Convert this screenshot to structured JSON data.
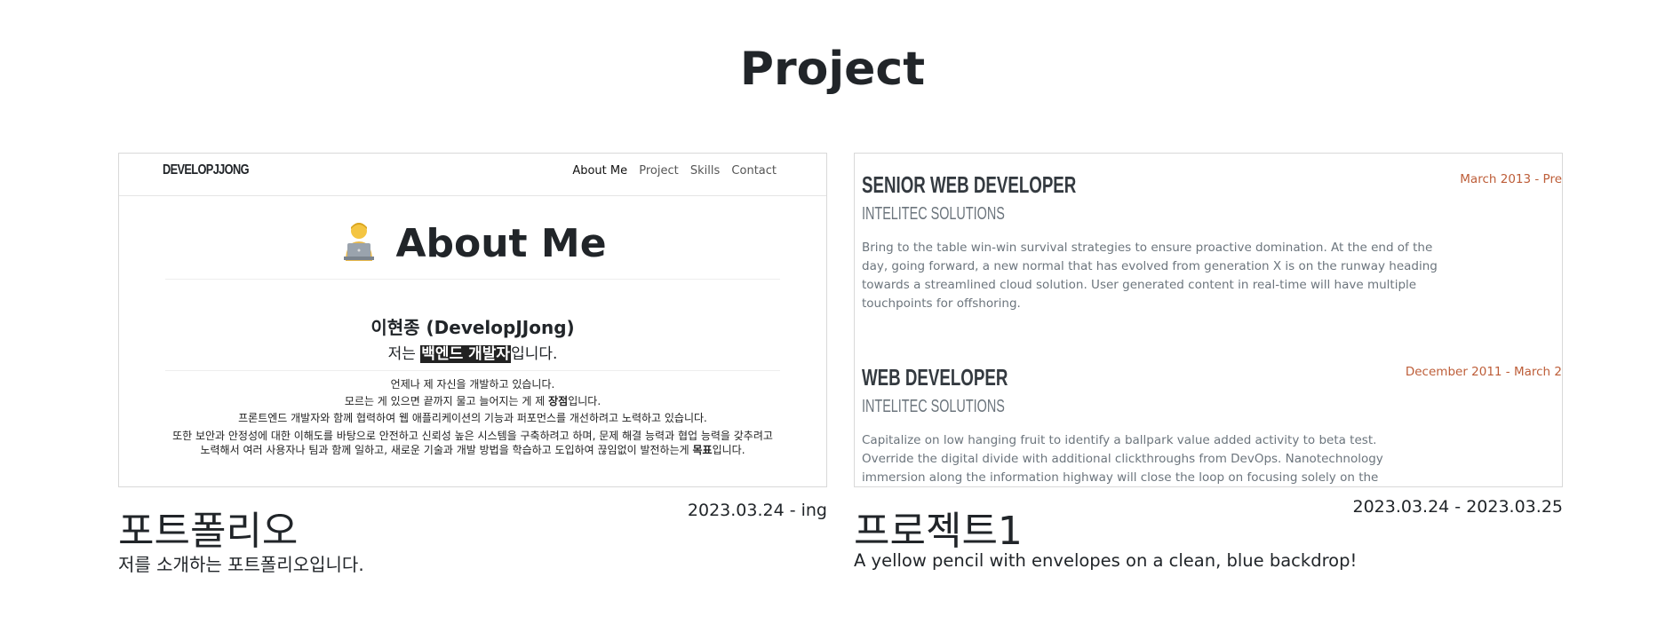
{
  "page_title": "Project",
  "projects": [
    {
      "title": "포트폴리오",
      "date": "2023.03.24 - ing",
      "description": "저를 소개하는 포트폴리오입니다.",
      "preview": {
        "brand": "DEVELOPJJONG",
        "nav": [
          "About Me",
          "Project",
          "Skills",
          "Contact"
        ],
        "heading": "About Me",
        "emoji_icon": "technologist-emoji",
        "name": "이현종 (DevelopJJong)",
        "role_prefix": "저는 ",
        "role_highlight": "백엔드 개발자",
        "role_suffix": "입니다.",
        "line1": "언제나 제 자신을 개발하고 있습니다.",
        "line2_prefix": "모르는 게 있으면 끝까지 물고 늘어지는 게 제 ",
        "line2_bold": "장점",
        "line2_suffix": "입니다.",
        "line3": "프론트엔드 개발자와 함께 협력하여 웹 애플리케이션의 기능과 퍼포먼스를 개선하려고 노력하고 있습니다.",
        "line4_prefix": "또한 보안과 안정성에 대한 이해도를 바탕으로 안전하고 신뢰성 높은 시스템을 구축하려고 하며, 문제 해결 능력과 협업 능력을 갖추려고 노력해서 여러 사용자나 팀과 함께 일하고, 새로운 기술과 개발 방법을 학습하고 도입하여 끊임없이 발전하는게 ",
        "line4_bold": "목표",
        "line4_suffix": "입니다."
      }
    },
    {
      "title": "프로젝트1",
      "date": "2023.03.24 - 2023.03.25",
      "description": "A yellow pencil with envelopes on a clean, blue backdrop!",
      "preview": {
        "jobs": [
          {
            "title": "SENIOR WEB DEVELOPER",
            "company": "INTELITEC SOLUTIONS",
            "date": "March 2013 - Pre",
            "text": "Bring to the table win-win survival strategies to ensure proactive domination. At the end of the day, going forward, a new normal that has evolved from generation X is on the runway heading towards a streamlined cloud solution. User generated content in real-time will have multiple touchpoints for offshoring."
          },
          {
            "title": "WEB DEVELOPER",
            "company": "INTELITEC SOLUTIONS",
            "date": "December 2011 - March 2",
            "text": "Capitalize on low hanging fruit to identify a ballpark value added activity to beta test. Override the digital divide with additional clickthroughs from DevOps. Nanotechnology immersion along the information highway will close the loop on focusing solely on the bottom line."
          }
        ],
        "accent_color": "#bd5d38"
      }
    }
  ]
}
